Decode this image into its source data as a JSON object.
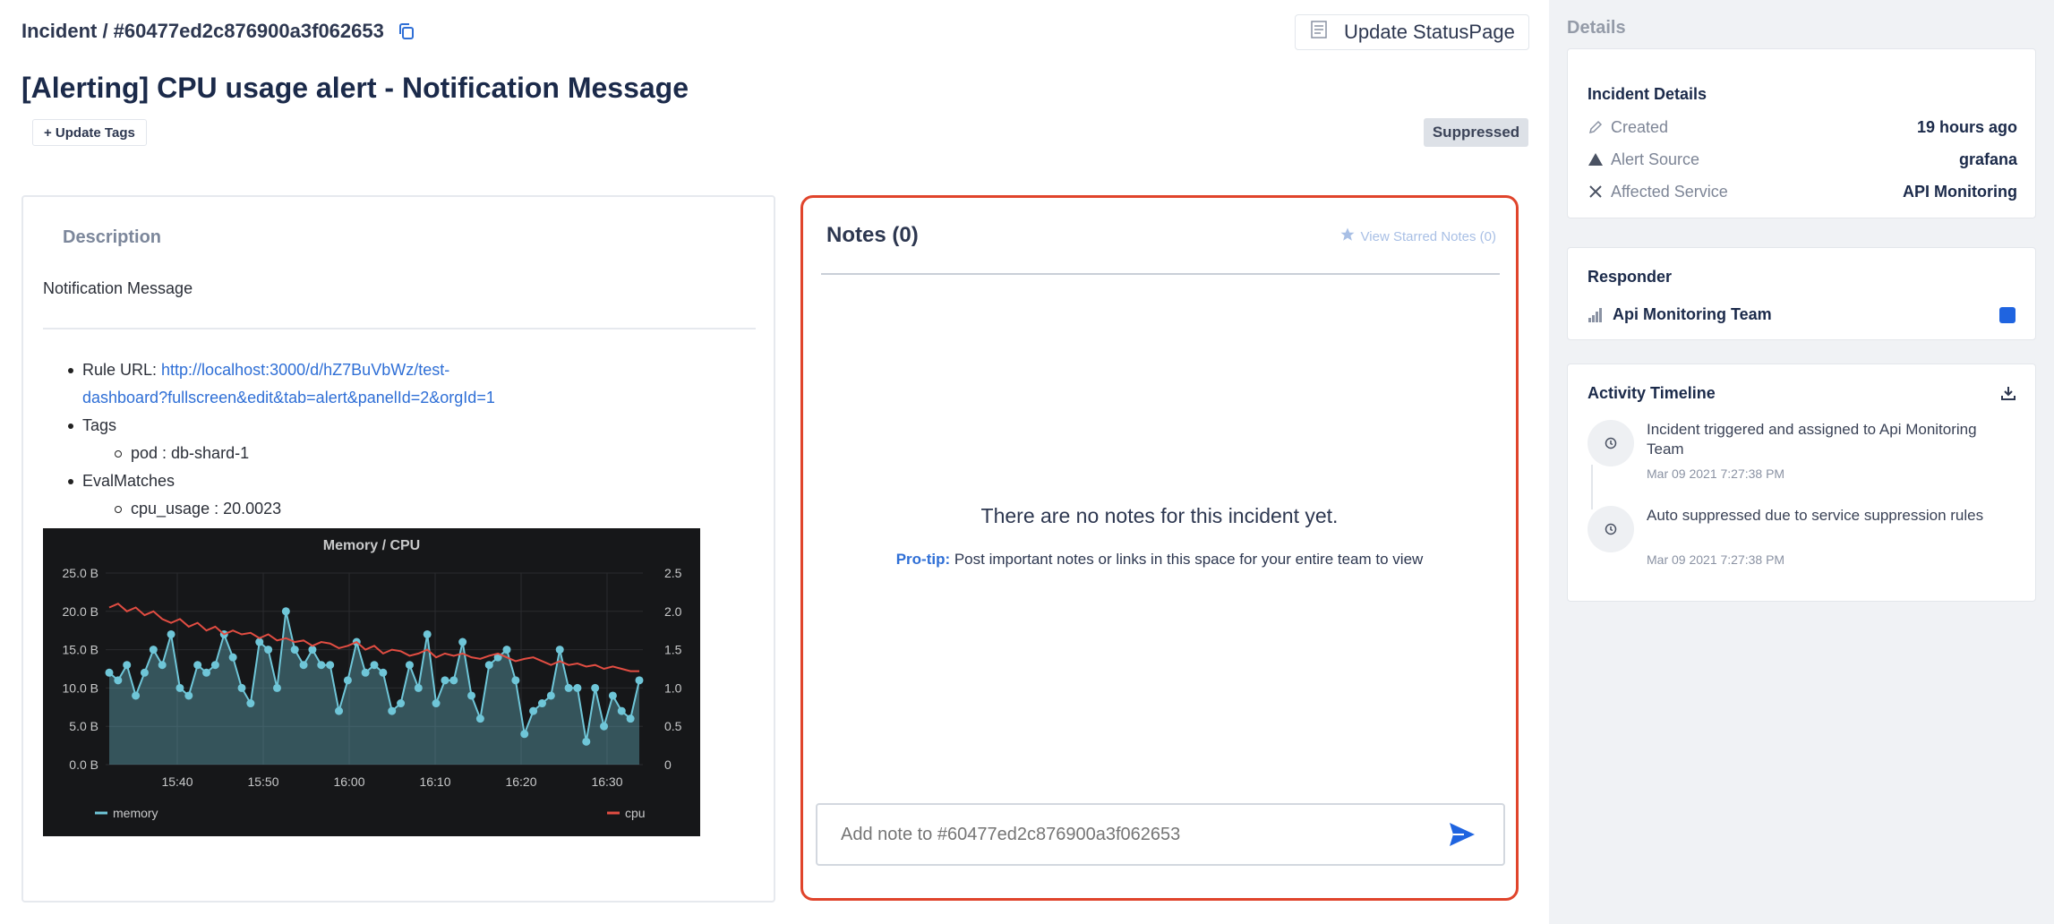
{
  "header": {
    "breadcrumb": "Incident / #60477ed2c876900a3f062653",
    "title": "[Alerting] CPU usage alert - Notification Message",
    "update_statuspage": "Update StatusPage",
    "update_tags": "+ Update Tags",
    "status_badge": "Suppressed"
  },
  "description": {
    "heading": "Description",
    "subtitle": "Notification Message",
    "rule_url_label": "Rule URL: ",
    "rule_url_line1": "http://localhost:3000/d/hZ7BuVbWz/test-",
    "rule_url_line2": "dashboard?fullscreen&edit&tab=alert&panelId=2&orgId=1",
    "tags_label": "Tags",
    "tag_item": "pod : db-shard-1",
    "evalmatches_label": "EvalMatches",
    "evalmatch_item": "cpu_usage : 20.0023"
  },
  "chart_data": {
    "type": "line",
    "title": "Memory / CPU",
    "x_ticks": [
      "15:40",
      "15:50",
      "16:00",
      "16:10",
      "16:20",
      "16:30"
    ],
    "y_left_ticks": [
      "0.0 B",
      "5.0 B",
      "10.0 B",
      "15.0 B",
      "20.0 B",
      "25.0 B"
    ],
    "y_right_ticks": [
      "0",
      "0.5",
      "1.0",
      "1.5",
      "2.0",
      "2.5"
    ],
    "ylim_left": [
      0,
      25
    ],
    "ylim_right": [
      0,
      2.5
    ],
    "legend_position": "bottom",
    "series": [
      {
        "name": "memory",
        "axis": "left",
        "color": "#6fc6d8",
        "values": [
          12,
          11,
          13,
          9,
          12,
          15,
          13,
          17,
          10,
          9,
          13,
          12,
          13,
          17,
          14,
          10,
          8,
          16,
          15,
          10,
          20,
          15,
          13,
          15,
          13,
          13,
          7,
          11,
          16,
          12,
          13,
          12,
          7,
          8,
          13,
          10,
          17,
          8,
          11,
          11,
          16,
          9,
          6,
          13,
          14,
          15,
          11,
          4,
          7,
          8,
          9,
          15,
          10,
          10,
          3,
          10,
          5,
          9,
          7,
          6,
          11
        ]
      },
      {
        "name": "cpu",
        "axis": "right",
        "color": "#e24d42",
        "values": [
          2.05,
          2.1,
          2.0,
          2.05,
          1.95,
          2.0,
          1.9,
          1.85,
          1.9,
          1.8,
          1.85,
          1.75,
          1.8,
          1.7,
          1.75,
          1.7,
          1.72,
          1.65,
          1.7,
          1.62,
          1.65,
          1.6,
          1.62,
          1.55,
          1.6,
          1.58,
          1.52,
          1.55,
          1.6,
          1.5,
          1.55,
          1.45,
          1.5,
          1.48,
          1.42,
          1.45,
          1.5,
          1.4,
          1.45,
          1.42,
          1.45,
          1.4,
          1.38,
          1.42,
          1.45,
          1.4,
          1.35,
          1.38,
          1.4,
          1.35,
          1.3,
          1.35,
          1.3,
          1.32,
          1.28,
          1.3,
          1.25,
          1.28,
          1.25,
          1.22,
          1.22
        ]
      }
    ]
  },
  "notes": {
    "title": "Notes (0)",
    "view_starred": "View Starred Notes (0)",
    "empty_message": "There are no notes for this incident yet.",
    "protip_label": "Pro-tip:",
    "protip_text": " Post important notes or links in this space for your entire team to view",
    "input_placeholder": "Add note to #60477ed2c876900a3f062653"
  },
  "sidebar": {
    "heading": "Details",
    "incident_details": {
      "title": "Incident Details",
      "rows": [
        {
          "label": "Created",
          "value": "19 hours ago",
          "icon": "pencil-icon"
        },
        {
          "label": "Alert Source",
          "value": "grafana",
          "icon": "warning-triangle-icon"
        },
        {
          "label": "Affected Service",
          "value": "API Monitoring",
          "icon": "tools-icon"
        }
      ]
    },
    "responder": {
      "title": "Responder",
      "team": "Api Monitoring Team",
      "team_color": "#1f64e0"
    },
    "timeline": {
      "title": "Activity Timeline",
      "items": [
        {
          "text": "Incident triggered and assigned to Api Monitoring Team",
          "time": "Mar 09 2021 7:27:38 PM"
        },
        {
          "text": "Auto suppressed due to service suppression rules",
          "time": "Mar 09 2021 7:27:38 PM"
        }
      ]
    }
  }
}
